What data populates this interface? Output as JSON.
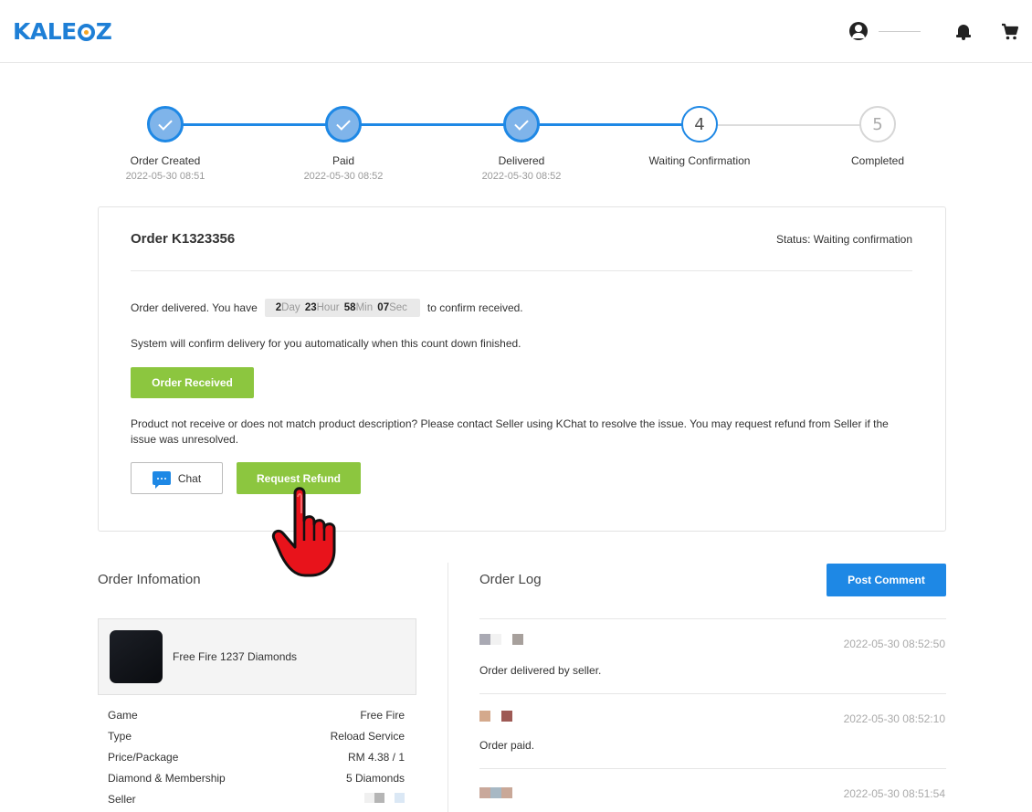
{
  "header": {
    "logo_text": "KALE",
    "logo_text_end": "Z",
    "icons": [
      "user-icon",
      "bell-icon",
      "cart-icon"
    ]
  },
  "steps": [
    {
      "label": "Order Created",
      "date": "2022-05-30 08:51",
      "state": "done"
    },
    {
      "label": "Paid",
      "date": "2022-05-30 08:52",
      "state": "done"
    },
    {
      "label": "Delivered",
      "date": "2022-05-30 08:52",
      "state": "done"
    },
    {
      "label": "Waiting Confirmation",
      "number": "4",
      "state": "current"
    },
    {
      "label": "Completed",
      "number": "5",
      "state": "todo"
    }
  ],
  "order": {
    "title": "Order K1323356",
    "status": "Status: Waiting confirmation",
    "delivered_prefix": "Order delivered. You have",
    "countdown": {
      "day": "2",
      "day_unit": "Day",
      "hour": "23",
      "hour_unit": "Hour",
      "min": "58",
      "min_unit": "Min",
      "sec": "07",
      "sec_unit": "Sec"
    },
    "delivered_suffix": "to confirm received.",
    "auto_confirm_text": "System will confirm delivery for you automatically when this count down finished.",
    "received_button": "Order Received",
    "problem_text": "Product not receive or does not match product description? Please contact Seller using KChat to resolve the issue. You may request refund from Seller if the issue was unresolved.",
    "chat_button": "Chat",
    "refund_button": "Request Refund"
  },
  "order_info": {
    "title": "Order Infomation",
    "product_name": "Free Fire 1237 Diamonds",
    "rows": [
      {
        "label": "Game",
        "value": "Free Fire"
      },
      {
        "label": "Type",
        "value": "Reload Service"
      },
      {
        "label": "Price/Package",
        "value": "RM 4.38 / 1"
      },
      {
        "label": "Diamond & Membership",
        "value": "5 Diamonds"
      },
      {
        "label": "Seller",
        "value": ""
      }
    ]
  },
  "order_log": {
    "title": "Order Log",
    "post_button": "Post Comment",
    "entries": [
      {
        "time": "2022-05-30 08:52:50",
        "text": "Order delivered by seller."
      },
      {
        "time": "2022-05-30 08:52:10",
        "text": "Order paid."
      },
      {
        "time": "2022-05-30 08:51:54",
        "text": ""
      }
    ]
  },
  "colors": {
    "brand_blue": "#1e88e5",
    "action_green": "#8cc63f",
    "step_done_fill": "#7fb4ea",
    "hand_pointer": "#e8131b"
  }
}
